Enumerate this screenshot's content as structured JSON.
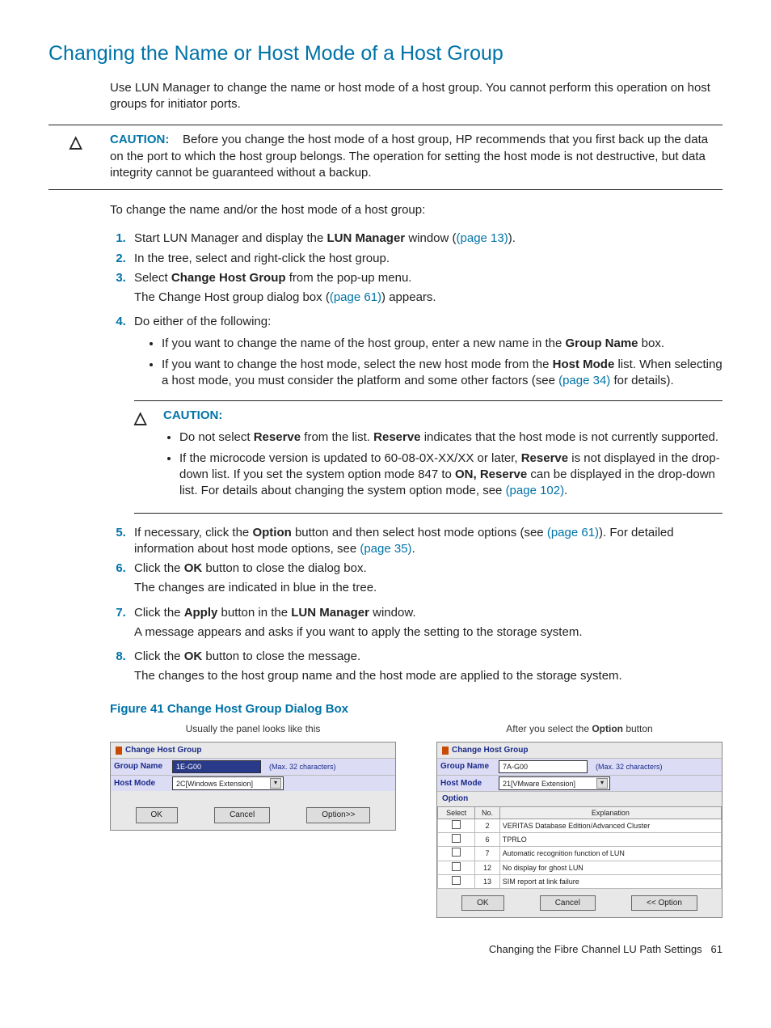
{
  "title": "Changing the Name or Host Mode of a Host Group",
  "intro": "Use LUN Manager to change the name or host mode of a host group. You cannot perform this operation on host groups for initiator ports.",
  "caution1": {
    "label": "CAUTION:",
    "text": "Before you change the host mode of a host group, HP recommends that you first back up the data on the port to which the host group belongs. The operation for setting the host mode is not destructive, but data integrity cannot be guaranteed without a backup."
  },
  "lead": "To change the name and/or the host mode of a host group:",
  "step1_a": "Start LUN Manager and display the ",
  "step1_b": "LUN Manager",
  "step1_c": " window (",
  "step1_link": "(page 13)",
  "step1_d": ").",
  "step2": "In the tree, select and right-click the host group.",
  "step3_a": "Select ",
  "step3_b": "Change Host Group",
  "step3_c": " from the pop-up menu.",
  "step3_extra_a": "The Change Host group dialog box (",
  "step3_extra_link": "(page 61)",
  "step3_extra_b": ") appears.",
  "step4": "Do either of the following:",
  "step4_b1_a": "If you want to change the name of the host group, enter a new name in the ",
  "step4_b1_b": "Group Name",
  "step4_b1_c": " box.",
  "step4_b2_a": "If you want to change the host mode, select the new host mode from the ",
  "step4_b2_b": "Host Mode",
  "step4_b2_c": " list. When selecting a host mode, you must consider the platform and some other factors (see ",
  "step4_b2_link": "(page 34)",
  "step4_b2_d": " for details).",
  "caution2": {
    "label": "CAUTION:",
    "b1_a": "Do not select ",
    "b1_b": "Reserve",
    "b1_c": " from the list. ",
    "b1_d": "Reserve",
    "b1_e": " indicates that the host mode is not currently supported.",
    "b2_a": "If the microcode version is updated to 60-08-0X-XX/XX or later, ",
    "b2_b": "Reserve",
    "b2_c": " is not displayed in the drop-down list. If you set the system option mode 847 to ",
    "b2_d": "ON, Reserve",
    "b2_e": " can be displayed in the drop-down list. For details about changing the system option mode, see ",
    "b2_link": "(page 102)",
    "b2_f": "."
  },
  "step5_a": "If necessary, click the ",
  "step5_b": "Option",
  "step5_c": " button and then select host mode options (see ",
  "step5_link1": "(page 61)",
  "step5_d": "). For detailed information about host mode options, see ",
  "step5_link2": "(page 35)",
  "step5_e": ".",
  "step6_a": "Click the ",
  "step6_b": "OK",
  "step6_c": " button to close the dialog box.",
  "step6_extra": "The changes are indicated in blue in the tree.",
  "step7_a": "Click the ",
  "step7_b": "Apply",
  "step7_c": " button in the ",
  "step7_d": "LUN Manager",
  "step7_e": " window.",
  "step7_extra": "A message appears and asks if you want to apply the setting to the storage system.",
  "step8_a": "Click the ",
  "step8_b": "OK",
  "step8_c": " button to close the message.",
  "step8_extra": "The changes to the host group name and the host mode are applied to the storage system.",
  "figure_title": "Figure 41 Change Host Group Dialog Box",
  "fig_left_caption": "Usually the panel looks like this",
  "fig_right_caption_a": "After you select the ",
  "fig_right_caption_b": "Option",
  "fig_right_caption_c": " button",
  "dialogL": {
    "title": "Change Host Group",
    "groupLabel": "Group Name",
    "groupValue": "1E-G00",
    "hint": "(Max. 32 characters)",
    "modeLabel": "Host Mode",
    "modeValue": "2C[Windows Extension]",
    "ok": "OK",
    "cancel": "Cancel",
    "option": "Option>>"
  },
  "dialogR": {
    "title": "Change Host Group",
    "groupLabel": "Group Name",
    "groupValue": "7A-G00",
    "hint": "(Max. 32 characters)",
    "modeLabel": "Host Mode",
    "modeValue": "21[VMware Extension]",
    "optionLabel": "Option",
    "th_sel": "Select",
    "th_no": "No.",
    "th_exp": "Explanation",
    "rows": [
      {
        "no": "2",
        "exp": "VERITAS Database Edition/Advanced Cluster"
      },
      {
        "no": "6",
        "exp": "TPRLO"
      },
      {
        "no": "7",
        "exp": "Automatic recognition function of LUN"
      },
      {
        "no": "12",
        "exp": "No display for ghost LUN"
      },
      {
        "no": "13",
        "exp": "SIM report at link failure"
      }
    ],
    "ok": "OK",
    "cancel": "Cancel",
    "option": "<< Option"
  },
  "footer_text": "Changing the Fibre Channel LU Path Settings",
  "footer_page": "61"
}
